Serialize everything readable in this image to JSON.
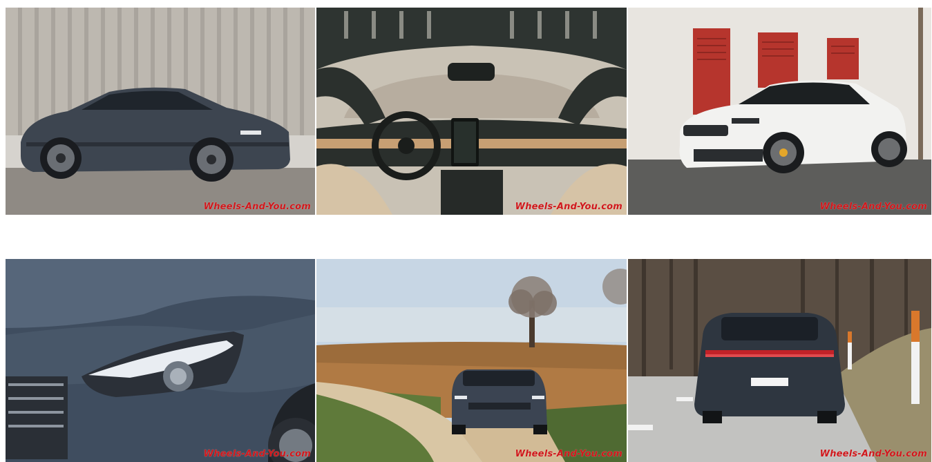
{
  "gallery": {
    "watermark": "Wheels-And-You.com",
    "watermark_color": "#d0181c",
    "photos": [
      {
        "subject": "car-side-view"
      },
      {
        "subject": "car-interior-dashboard"
      },
      {
        "subject": "car-front-quarter-white"
      },
      {
        "subject": "headlight-detail"
      },
      {
        "subject": "car-on-country-road"
      },
      {
        "subject": "car-rear-view-road"
      }
    ]
  }
}
